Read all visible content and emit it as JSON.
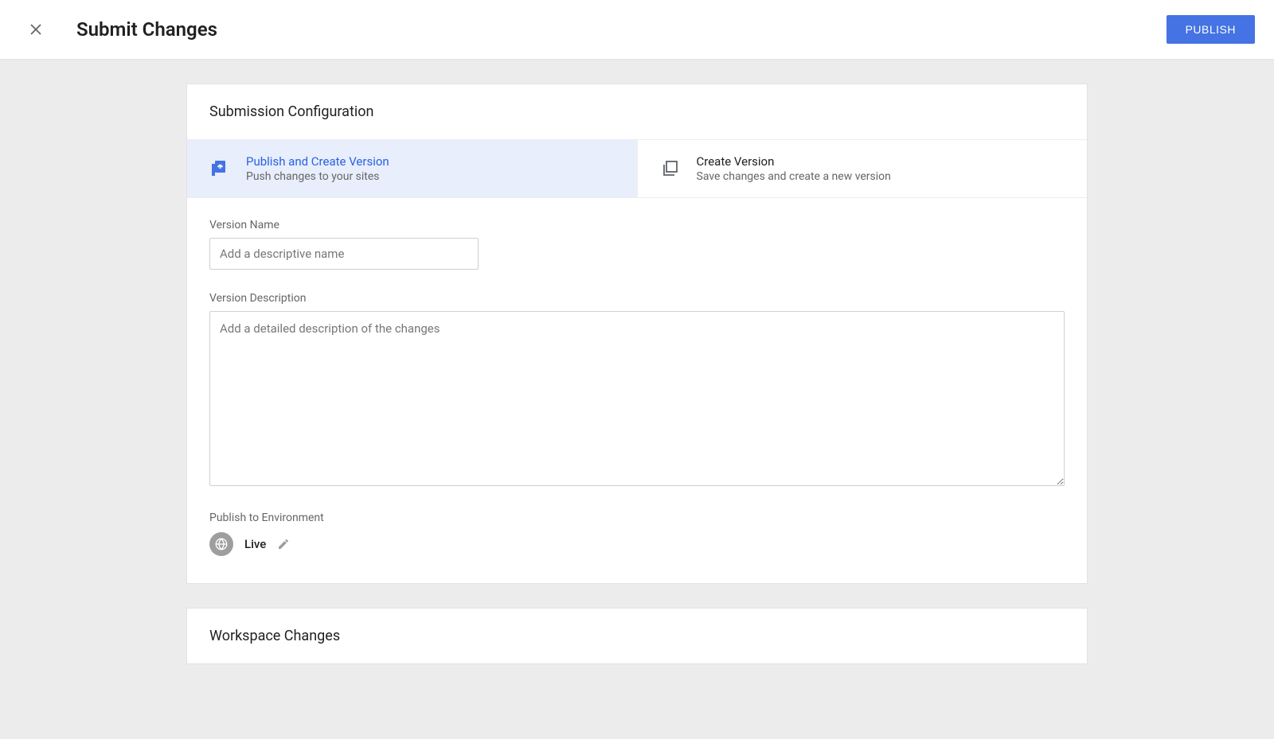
{
  "header": {
    "title": "Submit Changes",
    "publishButtonLabel": "PUBLISH"
  },
  "card1": {
    "title": "Submission Configuration",
    "options": [
      {
        "title": "Publish and Create Version",
        "desc": "Push changes to your sites",
        "selected": true
      },
      {
        "title": "Create Version",
        "desc": "Save changes and create a new version",
        "selected": false
      }
    ],
    "versionNameLabel": "Version Name",
    "versionNamePlaceholder": "Add a descriptive name",
    "versionDescLabel": "Version Description",
    "versionDescPlaceholder": "Add a detailed description of the changes",
    "publishEnvLabel": "Publish to Environment",
    "envName": "Live"
  },
  "card2": {
    "title": "Workspace Changes"
  }
}
